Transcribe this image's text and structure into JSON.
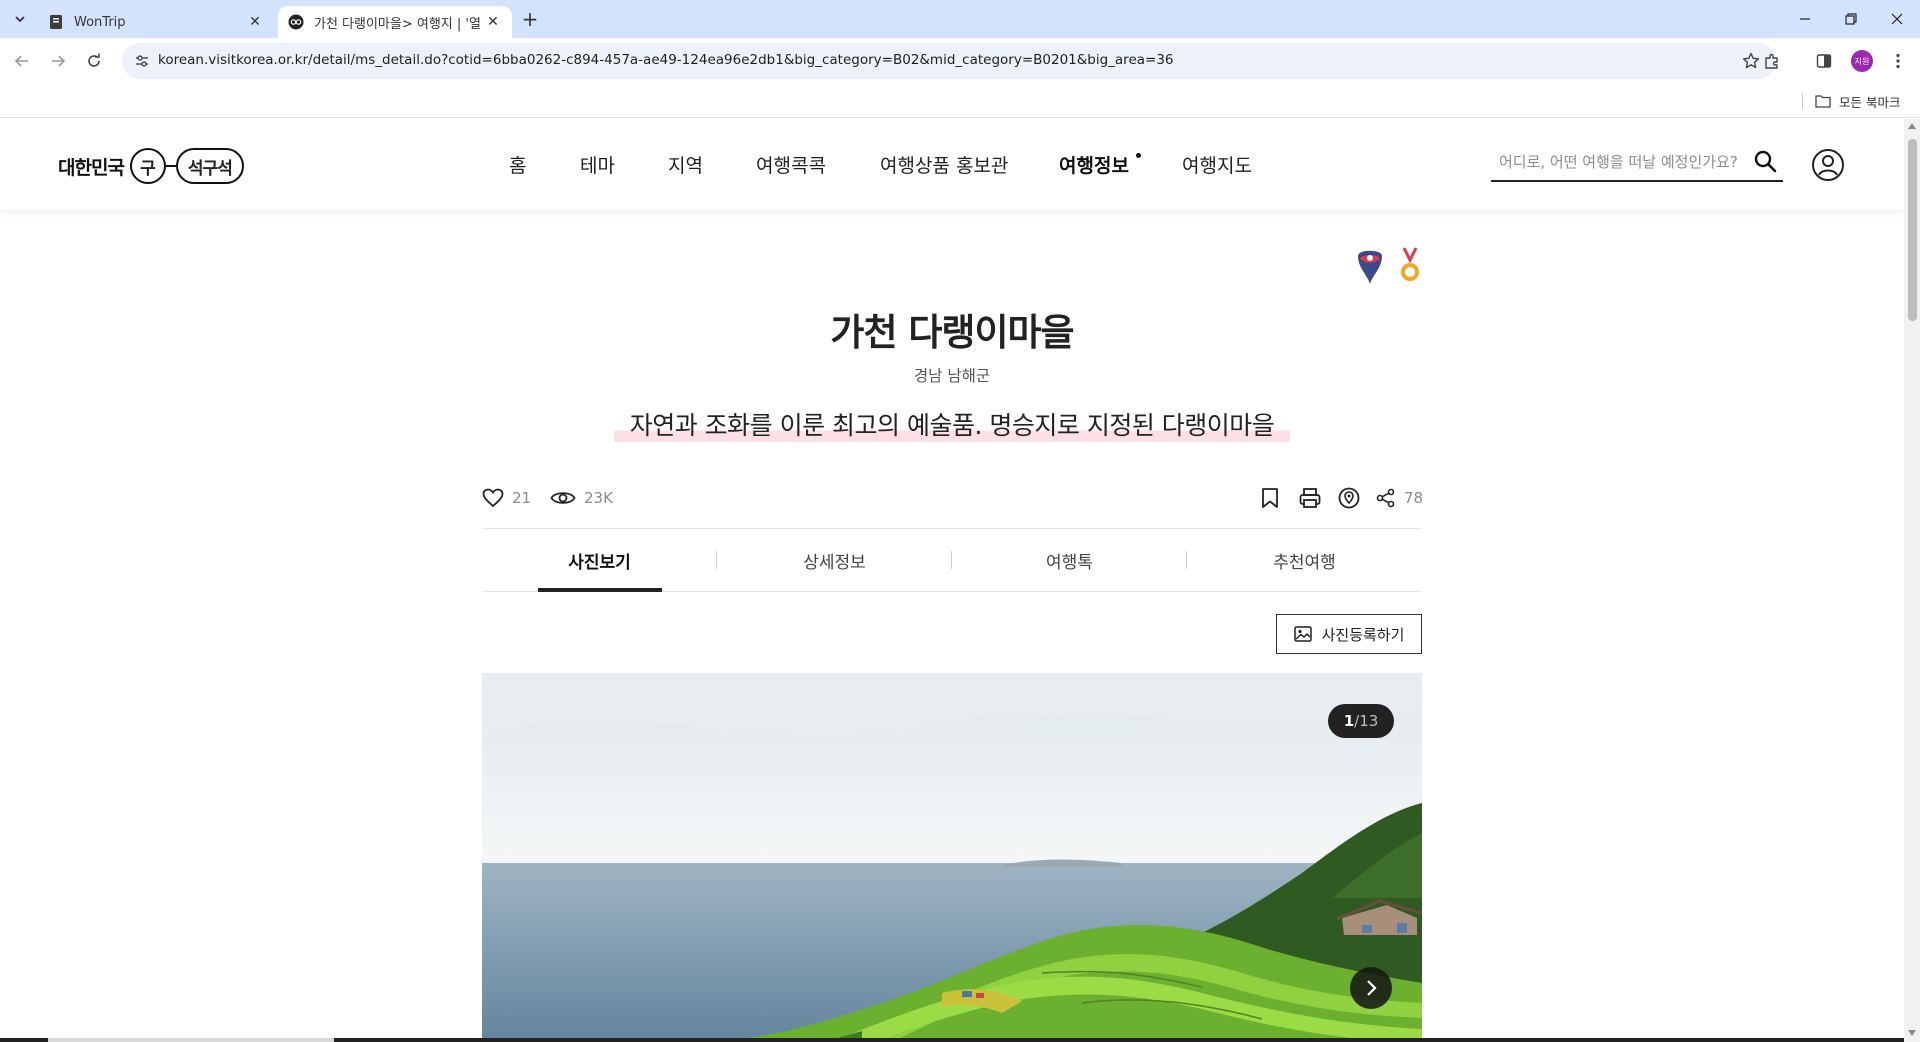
{
  "browser": {
    "tabs": [
      {
        "title": "WonTrip",
        "favicon": "document-icon"
      },
      {
        "title": "가천 다랭이마을> 여행지 | '열",
        "favicon": "visitkorea-icon",
        "active": true
      }
    ],
    "new_tab_label": "+",
    "url": "korean.visitkorea.or.kr/detail/ms_detail.do?cotid=6bba0262-c894-457a-ae49-124ea96e2db1&big_category=B02&mid_category=B0201&big_area=36",
    "profile_initial": "지원",
    "bookmarks_all": "모든 북마크"
  },
  "site": {
    "logo_text": "대한민국",
    "logo_circle": "구",
    "logo_pill": "석구석",
    "nav": [
      "홈",
      "테마",
      "지역",
      "여행콕콕",
      "여행상품 홍보관",
      "여행정보",
      "여행지도"
    ],
    "active_nav": "여행정보",
    "search_placeholder": "어디로, 어떤 여행을 떠날 예정인가요?"
  },
  "detail": {
    "title": "가천 다랭이마을",
    "region": "경남 남해군",
    "tagline": "자연과 조화를 이룬 최고의 예술품. 명승지로 지정된 다랭이마을",
    "likes": "21",
    "views": "23K",
    "shares": "78",
    "tabs": [
      "사진보기",
      "상세정보",
      "여행톡",
      "추천여행"
    ],
    "active_tab": "사진보기",
    "photo_button": "사진등록하기",
    "photo_current": "1",
    "photo_total": "/13"
  },
  "colors": {
    "tab_strip": "#d3e3fd",
    "omnibox": "#edf2fa",
    "highlight": "#fce0e6",
    "counter_bg": "#222222"
  }
}
